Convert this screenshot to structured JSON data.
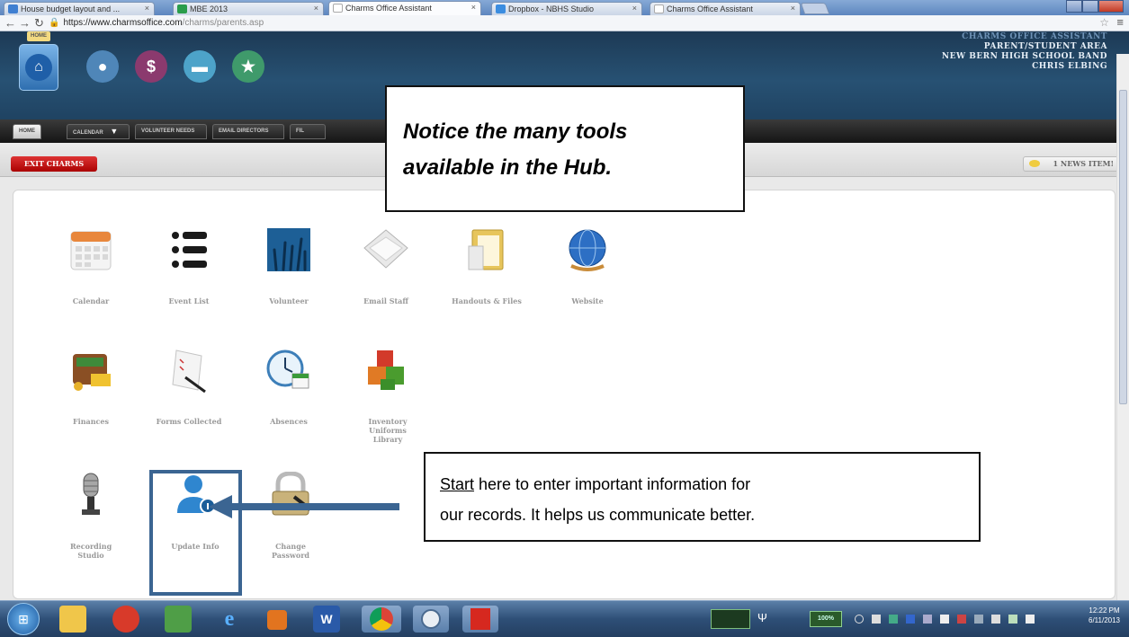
{
  "browser": {
    "tabs": [
      {
        "label": "House budget layout and ..."
      },
      {
        "label": "MBE 2013"
      },
      {
        "label": "Charms Office Assistant"
      },
      {
        "label": "Dropbox - NBHS Studio"
      },
      {
        "label": "Charms Office Assistant"
      }
    ],
    "url_host": "https://www.charmsoffice.com",
    "url_path": "/charms/parents.asp"
  },
  "header": {
    "home_label": "HOME",
    "title_lines": [
      "CHARMS OFFICE ASSISTANT",
      "PARENT/STUDENT AREA",
      "NEW BERN HIGH SCHOOL BAND",
      "CHRIS ELBING"
    ]
  },
  "nav_tabs": [
    "HOME",
    "CALENDAR",
    "VOLUNTEER NEEDS",
    "EMAIL DIRECTORS",
    "FIL"
  ],
  "exit_label": "EXIT CHARMS",
  "news_label": "1 NEWS ITEM!",
  "tools": [
    {
      "label": "Calendar",
      "icon": "calendar-icon"
    },
    {
      "label": "Event List",
      "icon": "list-icon"
    },
    {
      "label": "Volunteer",
      "icon": "volunteer-icon"
    },
    {
      "label": "Email Staff",
      "icon": "envelope-icon"
    },
    {
      "label": "Handouts & Files",
      "icon": "folder-icon"
    },
    {
      "label": "Website",
      "icon": "globe-icon"
    },
    {
      "label": "Finances",
      "icon": "wallet-icon"
    },
    {
      "label": "Forms Collected",
      "icon": "forms-icon"
    },
    {
      "label": "Absences",
      "icon": "clock-icon"
    },
    {
      "label": "Inventory Uniforms Library",
      "icon": "blocks-icon"
    },
    {
      "label": "Recording Studio",
      "icon": "microphone-icon"
    },
    {
      "label": "Update Info",
      "icon": "user-info-icon"
    },
    {
      "label": "Change Password",
      "icon": "padlock-icon"
    }
  ],
  "annotations": {
    "top_lines": [
      "Notice the many tools",
      "available in the Hub."
    ],
    "bottom_start": "Start",
    "bottom_rest_line1": " here to enter important information for",
    "bottom_line2": "our records. It helps us communicate better."
  },
  "taskbar": {
    "time": "12:22 PM",
    "date": "6/11/2013",
    "battery": "100%"
  }
}
